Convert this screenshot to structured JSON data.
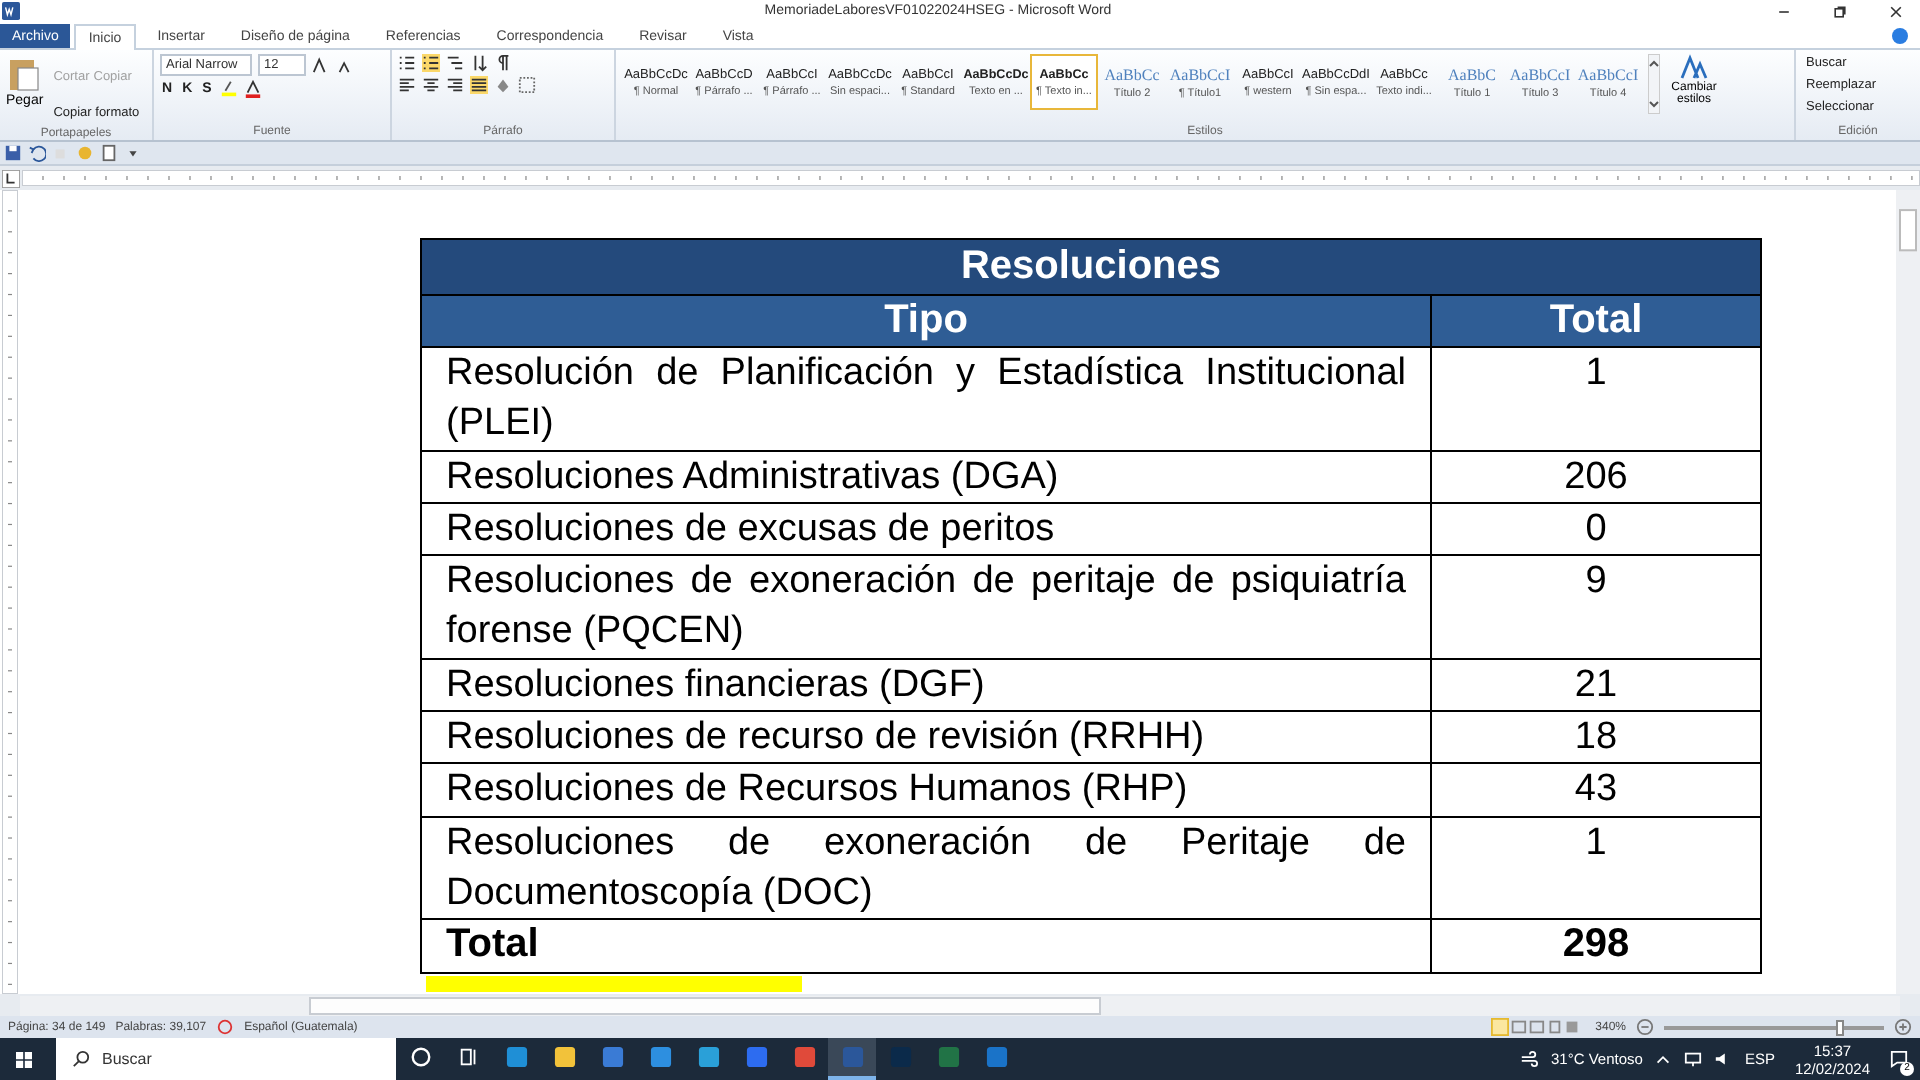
{
  "window": {
    "title": "MemoriadeLaboresVF01022024HSEG  -  Microsoft Word"
  },
  "ribbon": {
    "file_tab": "Archivo",
    "tabs": [
      {
        "label": "Inicio",
        "selected": true
      },
      {
        "label": "Insertar",
        "selected": false
      },
      {
        "label": "Diseño de página",
        "selected": false
      },
      {
        "label": "Referencias",
        "selected": false
      },
      {
        "label": "Correspondencia",
        "selected": false
      },
      {
        "label": "Revisar",
        "selected": false
      },
      {
        "label": "Vista",
        "selected": false
      }
    ],
    "clipboard": {
      "paste": "Pegar",
      "items": [
        {
          "label": "Cortar",
          "disabled": true
        },
        {
          "label": "Copiar",
          "disabled": true
        },
        {
          "label": "Copiar formato",
          "disabled": false
        }
      ],
      "group_label": "Portapapeles"
    },
    "font": {
      "family": "Arial Narrow",
      "size": "12",
      "format_buttons": [
        "N",
        "K",
        "S"
      ],
      "group_label": "Fuente"
    },
    "paragraph": {
      "group_label": "Párrafo"
    },
    "styles": {
      "items": [
        {
          "preview": "AaBbCcDc",
          "name": "¶ Normal",
          "kind": "plain",
          "selected": false
        },
        {
          "preview": "AaBbCcD",
          "name": "¶ Párrafo ...",
          "kind": "plain",
          "selected": false
        },
        {
          "preview": "AaBbCcI",
          "name": "¶ Párrafo ...",
          "kind": "plain",
          "selected": false
        },
        {
          "preview": "AaBbCcDc",
          "name": "Sin espaci...",
          "kind": "plain",
          "selected": false
        },
        {
          "preview": "AaBbCcI",
          "name": "¶ Standard",
          "kind": "plain",
          "selected": false
        },
        {
          "preview": "AaBbCcDc",
          "name": "Texto en ...",
          "kind": "bold",
          "selected": false
        },
        {
          "preview": "AaBbCc",
          "name": "¶ Texto in...",
          "kind": "bold",
          "selected": true
        },
        {
          "preview": "AaBbCc",
          "name": "Título 2",
          "kind": "heading",
          "selected": false
        },
        {
          "preview": "AaBbCcI",
          "name": "¶ Título1",
          "kind": "heading",
          "selected": false
        },
        {
          "preview": "AaBbCcI",
          "name": "¶ western",
          "kind": "plain",
          "selected": false
        },
        {
          "preview": "AaBbCcDdI",
          "name": "¶ Sin espa...",
          "kind": "plain",
          "selected": false
        },
        {
          "preview": "AaBbCc",
          "name": "Texto indi...",
          "kind": "plain",
          "selected": false
        },
        {
          "preview": "AaBbC",
          "name": "Título 1",
          "kind": "heading",
          "selected": false
        },
        {
          "preview": "AaBbCcI",
          "name": "Título 3",
          "kind": "heading",
          "selected": false
        },
        {
          "preview": "AaBbCcI",
          "name": "Título 4",
          "kind": "heading",
          "selected": false
        }
      ],
      "change_styles": "Cambiar estilos",
      "group_label": "Estilos"
    },
    "editing": {
      "items": [
        "Buscar",
        "Reemplazar",
        "Seleccionar"
      ],
      "group_label": "Edición"
    }
  },
  "document": {
    "table": {
      "title": "Resoluciones",
      "columns": [
        "Tipo",
        "Total"
      ],
      "rows": [
        {
          "tipo": "Resolución de Planificación y Estadística Institucional (PLEI)",
          "total": "1"
        },
        {
          "tipo": "Resoluciones Administrativas (DGA)",
          "total": "206"
        },
        {
          "tipo": "Resoluciones de excusas de peritos",
          "total": "0"
        },
        {
          "tipo": "Resoluciones de exoneración de peritaje de psiquiatría forense (PQCEN)",
          "total": "9"
        },
        {
          "tipo": "Resoluciones financieras (DGF)",
          "total": "21"
        },
        {
          "tipo": "Resoluciones de recurso de revisión (RRHH)",
          "total": "18"
        },
        {
          "tipo": "Resoluciones de Recursos Humanos (RHP)",
          "total": "43"
        },
        {
          "tipo": "Resoluciones de exoneración de Peritaje de Documentoscopía (DOC)",
          "total": "1"
        }
      ],
      "total_row": {
        "label": "Total",
        "value": "298"
      }
    }
  },
  "status_bar": {
    "page": "Página: 34 de 149",
    "words": "Palabras: 39,107",
    "language": "Español (Guatemala)",
    "zoom": "340%",
    "zoom_slider": {
      "level": 0.8
    }
  },
  "taskbar": {
    "search_placeholder": "Buscar",
    "apps": [
      {
        "kind": "cortana",
        "selected": false
      },
      {
        "kind": "taskview",
        "selected": false
      },
      {
        "kind": "edge",
        "selected": false
      },
      {
        "kind": "explorer",
        "selected": false
      },
      {
        "kind": "store",
        "selected": false
      },
      {
        "kind": "mail",
        "selected": false
      },
      {
        "kind": "monitor",
        "selected": false
      },
      {
        "kind": "zoom",
        "selected": false
      },
      {
        "kind": "chrome",
        "selected": false
      },
      {
        "kind": "word",
        "selected": true
      },
      {
        "kind": "photoshop",
        "selected": false
      },
      {
        "kind": "excel",
        "selected": false
      },
      {
        "kind": "outlook",
        "selected": false
      }
    ],
    "weather": "31°C  Ventoso",
    "input_language": "ESP",
    "time": "15:37",
    "date": "12/02/2024",
    "notifications": "2"
  }
}
